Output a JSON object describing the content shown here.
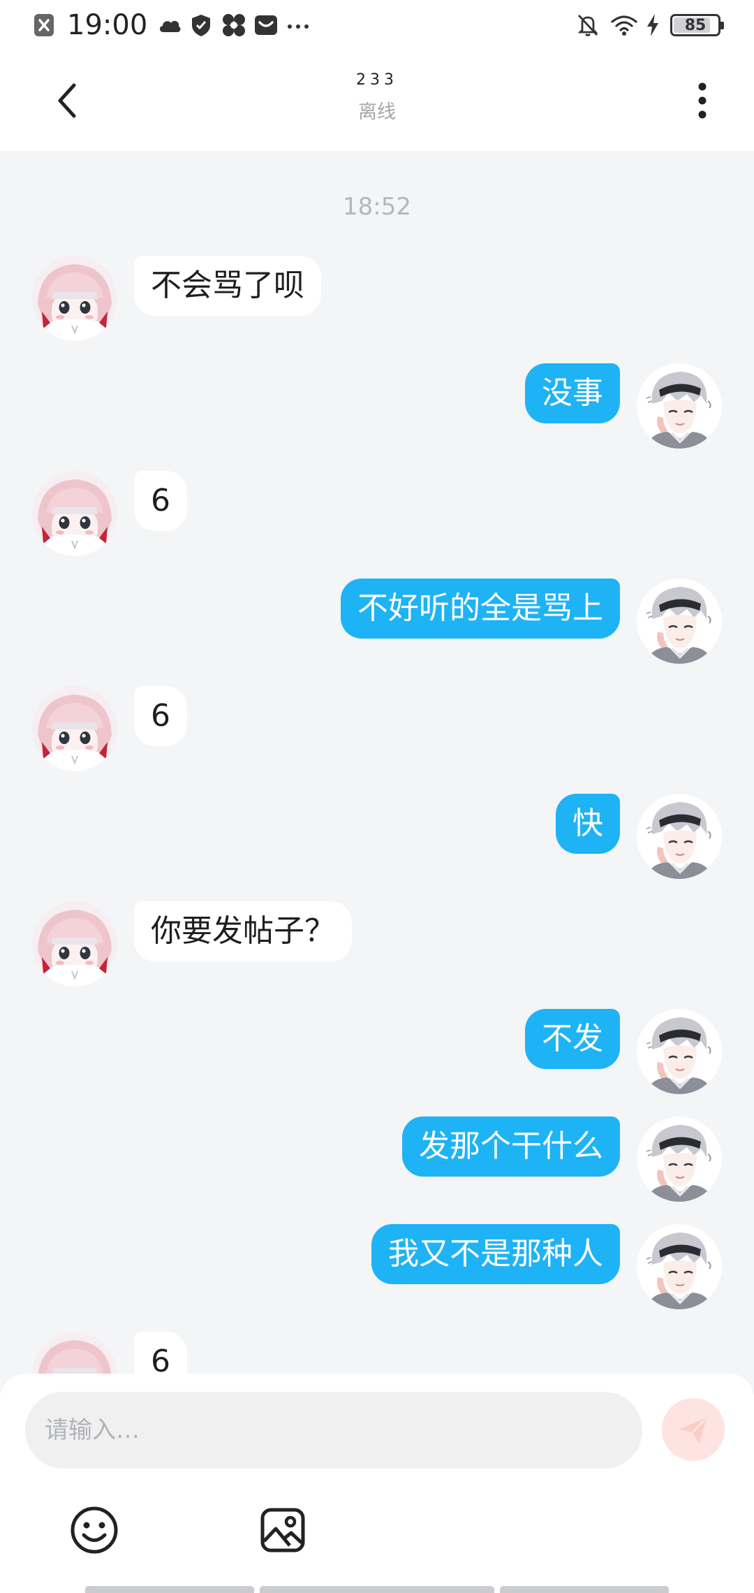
{
  "status_bar": {
    "time": "19:00",
    "battery": "85",
    "battery_level": 0.85,
    "left_icons": [
      "close-badge-icon",
      "cloud-icon",
      "shield-icon",
      "fan-icon",
      "mail-icon",
      "more-dots-icon"
    ],
    "right_icons": [
      "bell-off-icon",
      "wifi-icon",
      "charging-icon",
      "battery-icon"
    ]
  },
  "header": {
    "contact_name": "233",
    "status": "离线",
    "back_icon": "back-arrow-icon",
    "more_icon": "more-vertical-icon"
  },
  "chat": {
    "timestamp": "18:52",
    "messages": [
      {
        "side": "in",
        "text": "不会骂了呗"
      },
      {
        "side": "out",
        "text": "没事"
      },
      {
        "side": "in",
        "text": "6"
      },
      {
        "side": "out",
        "text": "不好听的全是骂上"
      },
      {
        "side": "in",
        "text": "6"
      },
      {
        "side": "out",
        "text": "快"
      },
      {
        "side": "in",
        "text": "你要发帖子？"
      },
      {
        "side": "out",
        "text": "不发"
      },
      {
        "side": "out",
        "text": "发那个干什么"
      },
      {
        "side": "out",
        "text": "我又不是那种人"
      },
      {
        "side": "in",
        "text": "6"
      }
    ]
  },
  "input": {
    "placeholder": "请输入…",
    "send_icon": "send-icon",
    "emoji_icon": "emoji-icon",
    "image_icon": "image-icon"
  },
  "colors": {
    "accent": "#1eb3f5",
    "background": "#f4f5f7",
    "incoming_bubble": "#ffffff",
    "send_button": "#fde4e1"
  }
}
